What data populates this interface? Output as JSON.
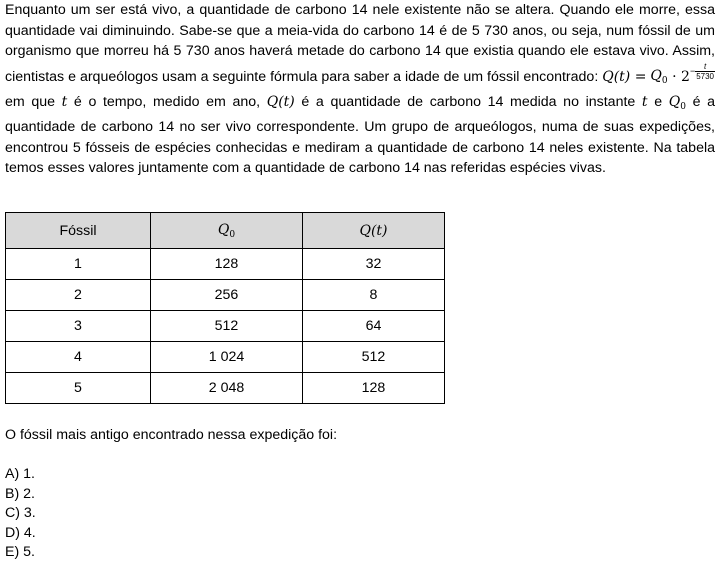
{
  "text": {
    "p1": "Enquanto um ser está vivo, a quantidade de carbono 14 nele existente não se altera. Quando ele morre, essa quantidade vai diminuindo. Sabe-se que a meia-vida do carbono 14 é de 5 730 anos, ou seja, num fóssil de um organismo que morreu há 5 730 anos haverá metade do carbono 14 que existia quando ele estava vivo. Assim, cientistas e arqueólogos usam a seguinte fórmula para saber a idade de um fóssil encontrado: ",
    "q_of_t": "Q(t) =",
    "q_letter": "Q",
    "zero_sub": "0",
    "dot_two": " · 2",
    "exp_sign": "−",
    "exp_num": "t",
    "exp_den": "5730",
    "p2": "  em que ",
    "t_var": "t",
    "p3": " é o tempo, medido em ano, ",
    "q_of_t2": "Q(t)",
    "p4": " é a quantidade de carbono 14 medida no instante ",
    "t_var2": "t",
    "p5": " e ",
    "p6": "  é a quantidade de carbono 14 no ser vivo correspondente. Um grupo de arqueólogos, numa de suas expedições, encontrou 5 fósseis de espécies conhecidas e mediram a quantidade de carbono 14 neles existente. Na tabela temos esses valores juntamente com a quantidade de carbono 14 nas referidas espécies vivas."
  },
  "table": {
    "headers": [
      "Fóssil",
      "Q",
      "Q(t)"
    ],
    "header_q0_sub": "0",
    "rows": [
      [
        "1",
        "128",
        "32"
      ],
      [
        "2",
        "256",
        "8"
      ],
      [
        "3",
        "512",
        "64"
      ],
      [
        "4",
        "1 024",
        "512"
      ],
      [
        "5",
        "2 048",
        "128"
      ]
    ]
  },
  "question": "O fóssil mais antigo encontrado nessa expedição foi:",
  "options": [
    "A) 1.",
    "B) 2.",
    "C) 3.",
    "D) 4.",
    "E) 5."
  ]
}
